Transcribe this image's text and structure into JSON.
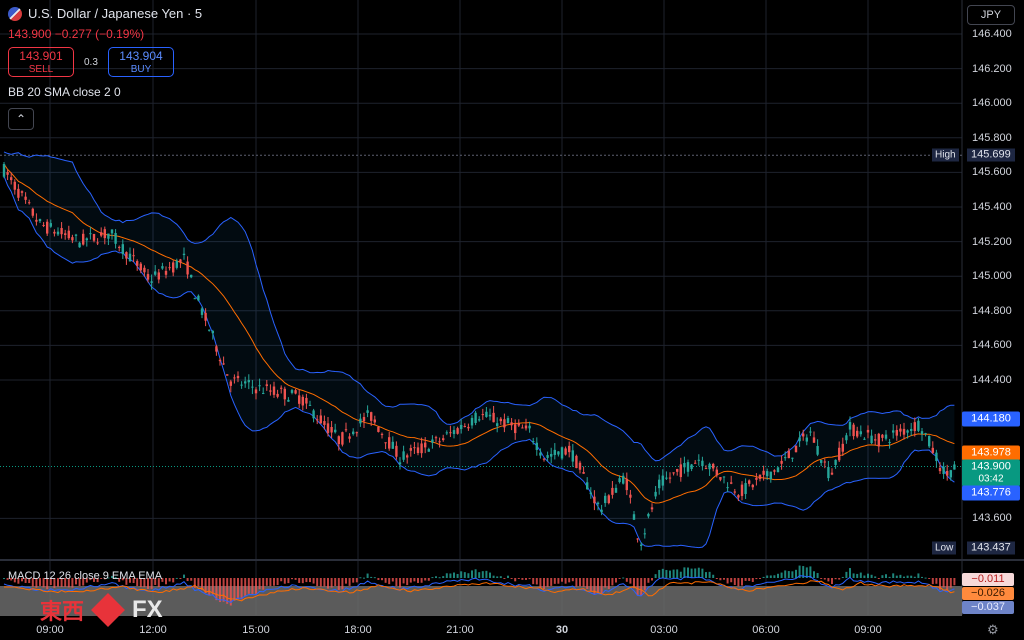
{
  "header": {
    "title": "U.S. Dollar / Japanese Yen · 5",
    "quote": "143.900 −0.277 (−0.19%)"
  },
  "trade": {
    "sell_price": "143.901",
    "sell_label": "SELL",
    "spread": "0.3",
    "buy_price": "143.904",
    "buy_label": "BUY"
  },
  "indicators": {
    "bb_label": "BB 20 SMA close 2 0",
    "macd_label": "MACD 12 26 close 9 EMA EMA"
  },
  "currency": "JPY",
  "price_axis": {
    "ticks": [
      "146.400",
      "146.200",
      "146.000",
      "145.800",
      "145.600",
      "145.400",
      "145.200",
      "145.000",
      "144.800",
      "144.600",
      "144.400",
      "143.600"
    ],
    "high_label": "High",
    "high_value": "145.699",
    "low_label": "Low",
    "low_value": "143.437",
    "upper_band": "144.180",
    "mid_band": "143.978",
    "last_price": "143.900",
    "countdown": "03:42",
    "lower_band": "143.776",
    "colors": {
      "up": "#26a69a",
      "down": "#ef5350",
      "band": "#2962ff",
      "basis": "#ff6d00"
    }
  },
  "macd_axis": {
    "macd": "−0.011",
    "signal": "−0.026",
    "hist": "−0.037"
  },
  "time_axis": {
    "ticks": [
      "09:00",
      "12:00",
      "15:00",
      "18:00",
      "21:00",
      "30",
      "03:00",
      "06:00",
      "09:00"
    ]
  },
  "watermark": {
    "cn": "東西",
    "fx": "FX"
  },
  "chart_data": {
    "type": "line",
    "title": "U.S. Dollar / Japanese Yen · 5",
    "ylim": [
      143.4,
      146.45
    ],
    "x": [
      "09:00",
      "12:00",
      "15:00",
      "18:00",
      "21:00",
      "30",
      "03:00",
      "06:00",
      "09:00"
    ],
    "series": [
      {
        "name": "BB 20 SMA close 2 0",
        "values": [
          145.55,
          145.25,
          144.95,
          144.5,
          144.25,
          144.15,
          143.9,
          143.85,
          143.85,
          143.98
        ]
      }
    ]
  }
}
